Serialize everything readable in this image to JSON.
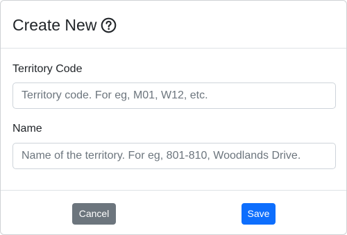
{
  "modal": {
    "title": "Create New",
    "help_icon": "question-circle-icon"
  },
  "form": {
    "territory_code": {
      "label": "Territory Code",
      "value": "",
      "placeholder": "Territory code. For eg, M01, W12, etc."
    },
    "name": {
      "label": "Name",
      "value": "",
      "placeholder": "Name of the territory. For eg, 801-810, Woodlands Drive."
    }
  },
  "footer": {
    "cancel_label": "Cancel",
    "save_label": "Save"
  },
  "colors": {
    "primary": "#0d6efd",
    "secondary": "#6c757d",
    "text": "#212529",
    "border": "#ced4da"
  }
}
